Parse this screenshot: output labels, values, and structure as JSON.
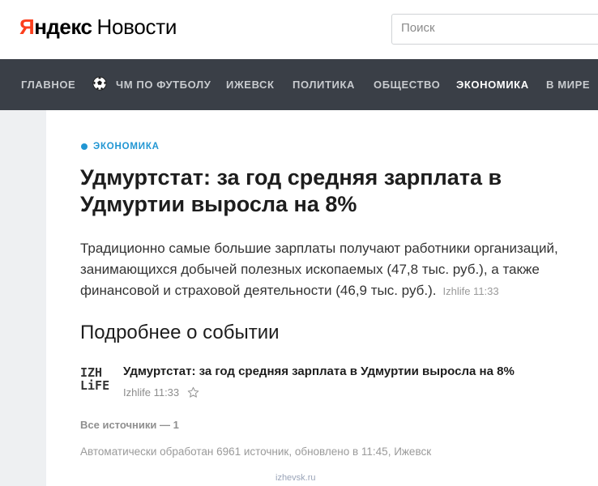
{
  "header": {
    "logo_brand_first": "Я",
    "logo_brand_rest": "ндекс",
    "logo_product": "Новости",
    "search_placeholder": "Поиск"
  },
  "nav": {
    "items": [
      {
        "label": "ГЛАВНОЕ",
        "active": false
      },
      {
        "label": "ЧМ ПО ФУТБОЛУ",
        "active": false,
        "icon": "football-icon"
      },
      {
        "label": "ИЖЕВСК",
        "active": false
      },
      {
        "label": "ПОЛИТИКА",
        "active": false
      },
      {
        "label": "ОБЩЕСТВО",
        "active": false
      },
      {
        "label": "ЭКОНОМИКА",
        "active": true
      },
      {
        "label": "В МИРЕ",
        "active": false
      }
    ]
  },
  "article": {
    "rubric": "ЭКОНОМИКА",
    "title": "Удмуртстат: за год средняя зарплата в Удмуртии выросла на 8%",
    "lead": "Традиционно самые большие зарплаты получают работники организаций, занимающихся добычей полезных ископаемых (47,8 тыс. руб.), а также финансовой и страховой деятельности (46,9 тыс. руб.).",
    "lead_source": "Izhlife 11:33"
  },
  "details": {
    "heading": "Подробнее о событии",
    "source_logo_line1": "IZH",
    "source_logo_line2": "LiFE",
    "item_title": "Удмуртстат: за год средняя зарплата в Удмуртии выросла на 8%",
    "item_meta": "Izhlife 11:33",
    "all_sources": "Все источники — 1",
    "auto_note": "Автоматически обработан 6961 источник, обновлено в 11:45, Ижевск"
  },
  "watermark": "izhevsk.ru",
  "colors": {
    "brand_red": "#fc3f1d",
    "nav_bg": "#3a3f47",
    "rubric_blue": "#2196d3"
  }
}
